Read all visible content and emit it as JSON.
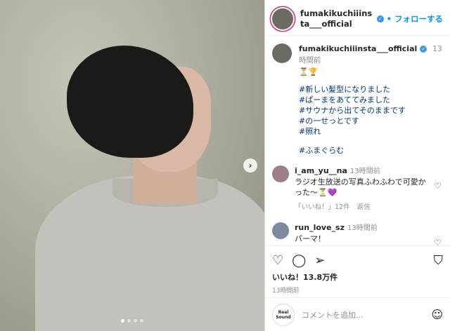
{
  "post": {
    "author": "fumakikuchiiinsta___official",
    "follow_label": "フォローする",
    "separator": "•",
    "more_icon": "more-options-icon",
    "caption": {
      "author": "fumakikuchiiinsta___official",
      "time": "13時間前",
      "emoji": "⏳🏆",
      "lines": [
        "#新しい髪型になりました",
        "#ぱーまをあててみました",
        "#サウナから出てそのままです",
        "#の一せっとです",
        "#照れ"
      ],
      "tag_last": "#ふまぐらむ"
    },
    "comments": [
      {
        "user": "i_am_yu__na",
        "time": "13時間前",
        "text": "ラジオ生放送の写真ふわふわで可愛かった〜⏳💜",
        "likes": "「いいね！」12件",
        "reply": "返信",
        "avatar_color": "#9c7f86"
      },
      {
        "user": "run_love_sz",
        "time": "13時間前",
        "text": "パーマ！",
        "avatar_color": "#7f8aa0"
      }
    ],
    "likes": "いいね！13.8万件",
    "timestamp": "13時間前",
    "add_comment_placeholder": "コメントを追加...",
    "real_sound_line1": "Real",
    "real_sound_line2": "Sound",
    "carousel_next": "›",
    "colors": {
      "link": "#0095f6",
      "hashtag": "#00376b",
      "muted": "#8e8e8e"
    }
  }
}
